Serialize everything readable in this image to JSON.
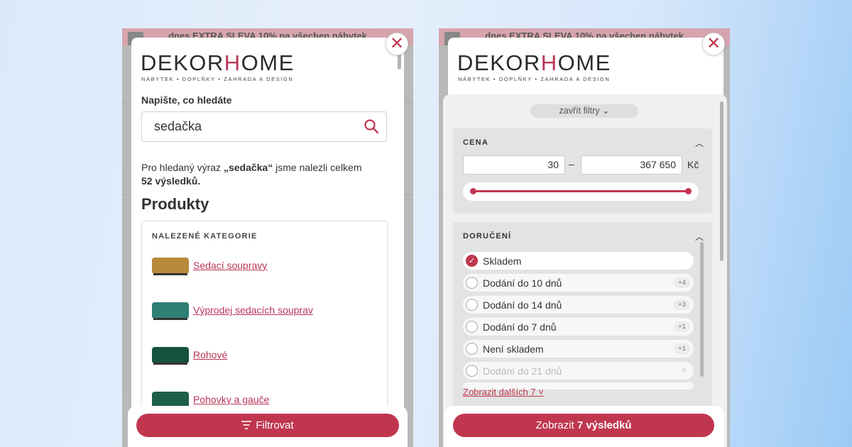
{
  "left": {
    "banner": "dnes EXTRA SLEVA 10% na všechen nábytek",
    "logo_pre": "DEKOR",
    "logo_h": "H",
    "logo_post": "OME",
    "tagline": "NÁBYTEK • DOPLŇKY • ZAHRADA A DESIGN",
    "close_glyph": "✕",
    "search_label": "Napište, co hledáte",
    "search_value": "sedačka",
    "result_pre": "Pro hledaný výraz ",
    "result_term": "„sedačka“",
    "result_mid": " jsme nalezli celkem",
    "result_count": "52 výsledků.",
    "section_title": "Produkty",
    "categories_heading": "NALEZENÉ KATEGORIE",
    "categories": [
      {
        "label": "Sedací soupravy",
        "color": "#b88a3c"
      },
      {
        "label": "Výprodej sedacích souprav",
        "color": "#2e7f76"
      },
      {
        "label": "Rohové",
        "color": "#15513f"
      },
      {
        "label": "Pohovky a gauče",
        "color": "#1d5f4a"
      }
    ],
    "button_label": "Filtrovat",
    "button_icon": "filter-icon"
  },
  "right": {
    "banner": "dnes EXTRA SLEVA 10% na všechen nábytek",
    "logo_pre": "DEKOR",
    "logo_h": "H",
    "logo_post": "OME",
    "tagline": "NÁBYTEK • DOPLŇKY • ZAHRADA A DESIGN",
    "close_glyph": "✕",
    "close_filters": "zavřít filtry",
    "price_heading": "CENA",
    "price_min": "30",
    "price_dash": "–",
    "price_max": "367 650",
    "currency": "Kč",
    "delivery_heading": "DORUČENÍ",
    "delivery_options": [
      {
        "label": "Skladem",
        "count": "",
        "checked": true
      },
      {
        "label": "Dodání do 10 dnů",
        "count": "+4",
        "checked": false
      },
      {
        "label": "Dodání do 14 dnů",
        "count": "+3",
        "checked": false
      },
      {
        "label": "Dodání do 7 dnů",
        "count": "+1",
        "checked": false
      },
      {
        "label": "Není skladem",
        "count": "+1",
        "checked": false
      },
      {
        "label": "Dodání do 21 dnů",
        "count": "0",
        "checked": false
      }
    ],
    "show_more": "Zobrazit dalších 7 ˅",
    "button_pre": "Zobrazit ",
    "button_bold": "7 výsledků"
  },
  "accent_color": "#c0364f"
}
